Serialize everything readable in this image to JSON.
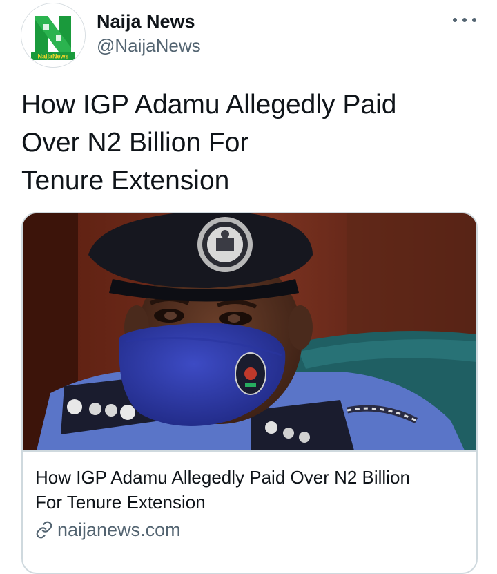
{
  "account": {
    "display_name": "Naija News",
    "handle": "@NaijaNews",
    "avatar_badge_text": "NaijaNews"
  },
  "tweet": {
    "text_lines": [
      "How IGP Adamu Allegedly Paid",
      "Over N2 Billion For",
      "Tenure Extension"
    ]
  },
  "link_card": {
    "title_lines": [
      "How IGP Adamu Allegedly Paid Over N2 Billion",
      "For Tenure Extension"
    ],
    "domain": "naijanews.com",
    "image_icon": "photo-of-police-officer-in-mask"
  },
  "icons": {
    "more": "more-options-icon",
    "link": "link-icon"
  },
  "colors": {
    "text_primary": "#0f1419",
    "text_secondary": "#536471",
    "card_border": "#cfd9de",
    "brand_green": "#1a9a3c"
  }
}
